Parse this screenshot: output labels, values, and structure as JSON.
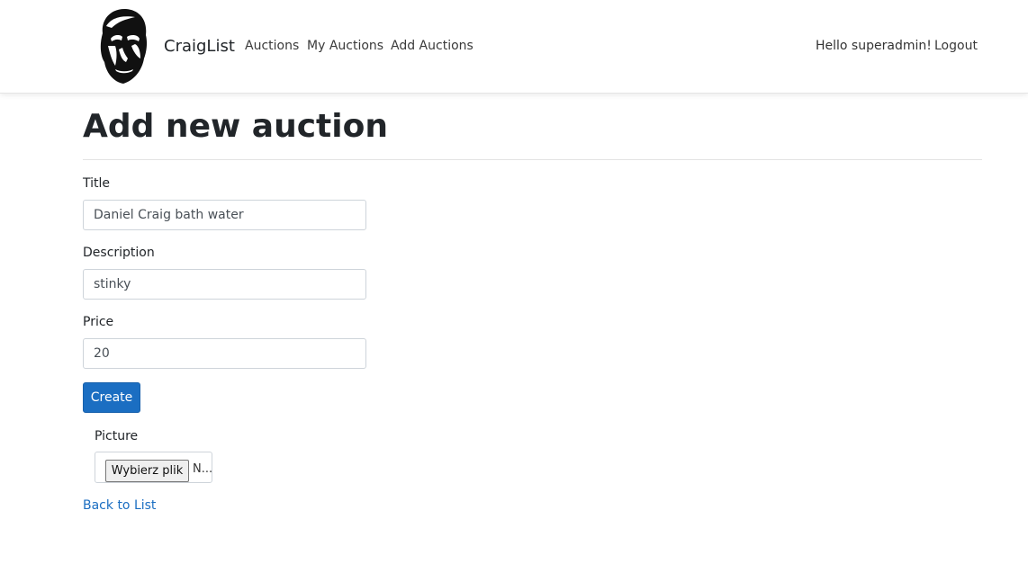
{
  "navbar": {
    "brand": "CraigList",
    "links": [
      "Auctions",
      "My Auctions",
      "Add Auctions"
    ],
    "greeting": "Hello superadmin!",
    "logout": "Logout"
  },
  "page": {
    "title": "Add new auction"
  },
  "form": {
    "title_label": "Title",
    "title_value": "Daniel Craig bath water",
    "description_label": "Description",
    "description_value": "stinky",
    "price_label": "Price",
    "price_value": "20",
    "create_label": "Create",
    "picture_label": "Picture",
    "file_button_label": "Wybierz plik",
    "file_status": "N..."
  },
  "footer_link": {
    "back_label": "Back to List"
  },
  "colors": {
    "primary": "#1b6ec2",
    "text": "#212529",
    "border": "#ced4da"
  },
  "icons": {
    "logo": "daniel-craig-face-logo"
  }
}
